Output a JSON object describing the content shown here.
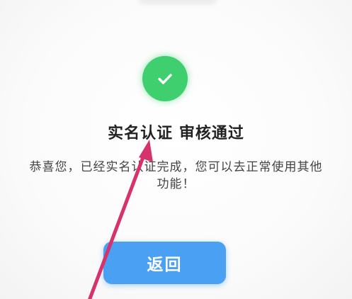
{
  "result": {
    "title": "实名认证 审核通过",
    "message": "恭喜您，已经实名认证完成，您可以去正常使用其他功能！",
    "back_label": "返回"
  },
  "colors": {
    "success_icon": "#3fcf6f",
    "back_button": "#4aa0f2",
    "annotation_arrow": "#d6336c"
  },
  "icons": {
    "success": "checkmark-icon",
    "annotation": "annotation-arrow"
  }
}
